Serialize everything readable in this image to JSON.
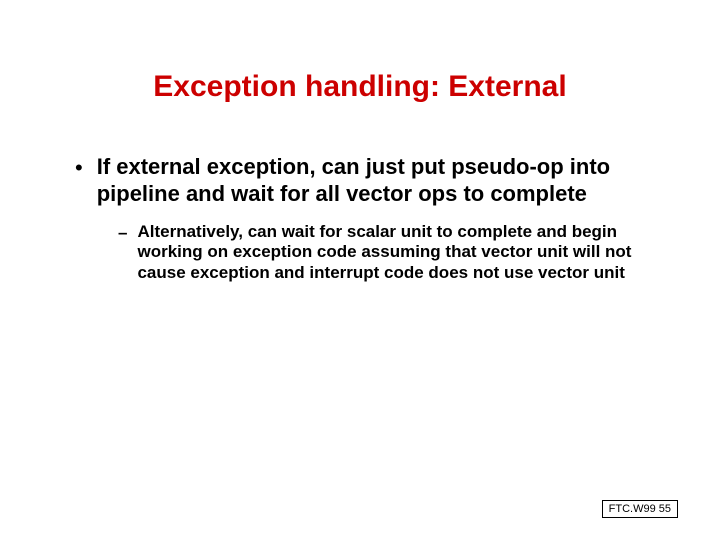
{
  "title": "Exception handling: External",
  "bullets": {
    "level1": {
      "marker": "•",
      "text": "If external exception, can just put pseudo-op into pipeline and wait for all vector ops to complete"
    },
    "level2": {
      "marker": "–",
      "text": "Alternatively, can wait for scalar unit to complete and begin working on exception code assuming that vector unit will not cause exception and interrupt code does not use vector unit"
    }
  },
  "footer": "FTC.W99 55"
}
